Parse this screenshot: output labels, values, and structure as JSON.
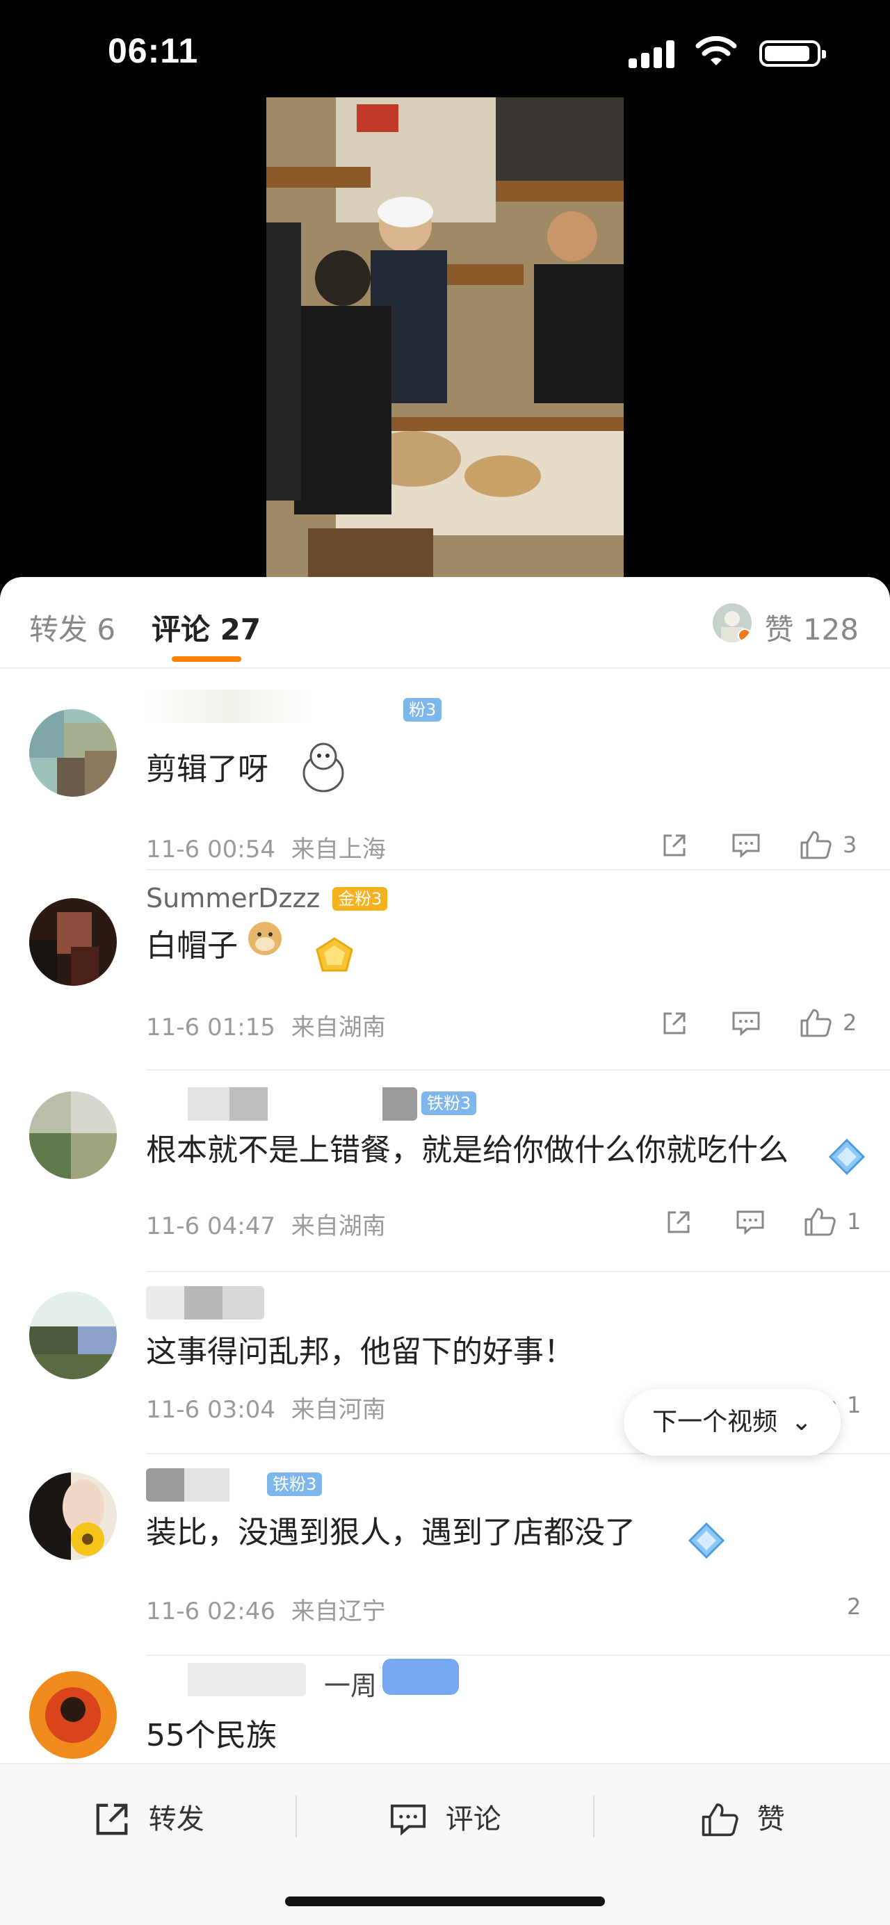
{
  "status_bar": {
    "time": "06:11"
  },
  "tabs": {
    "repost_label": "转发 6",
    "comments_label": "评论 27",
    "likes_label": "赞 128"
  },
  "comments": [
    {
      "username": "",
      "badge": "粉3",
      "text": "剪辑了呀",
      "time": "11-6 00:54",
      "location": "来自上海",
      "likes": "3"
    },
    {
      "username": "SummerDzzz",
      "badge": "金粉3",
      "text": "白帽子",
      "time": "11-6 01:15",
      "location": "来自湖南",
      "likes": "2"
    },
    {
      "username": "",
      "badge": "铁粉3",
      "text": "根本就不是上错餐，就是给你做什么你就吃什么",
      "time": "11-6 04:47",
      "location": "来自湖南",
      "likes": "1"
    },
    {
      "username": "",
      "badge": "",
      "text": "这事得问乱邦，他留下的好事！",
      "time": "11-6 03:04",
      "location": "来自河南",
      "likes": "1"
    },
    {
      "username": "",
      "badge": "铁粉3",
      "text": "装比，没遇到狠人，遇到了店都没了",
      "time": "11-6 02:46",
      "location": "来自辽宁",
      "likes": "2"
    },
    {
      "username": "一周",
      "badge": "",
      "text": "55个民族",
      "time": "",
      "location": "",
      "likes": ""
    }
  ],
  "next_video_label": "下一个视频",
  "bottom_bar": {
    "repost": "转发",
    "comment": "评论",
    "like": "赞"
  }
}
